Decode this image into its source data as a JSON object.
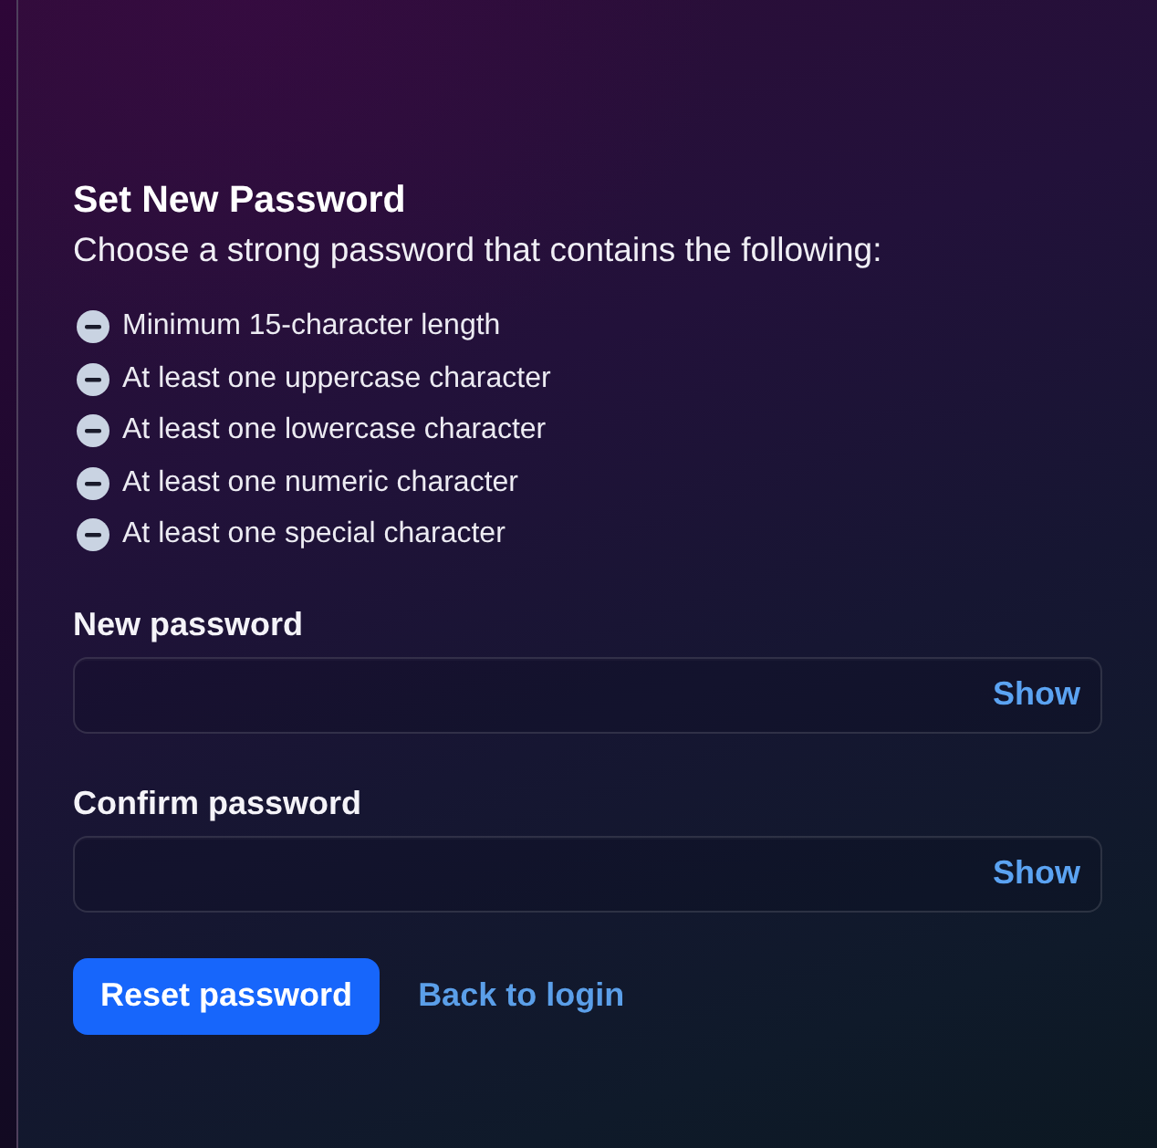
{
  "heading": {
    "title": "Set New Password",
    "subtitle": "Choose a strong password that contains the following:"
  },
  "requirements": [
    {
      "label": "Minimum 15-character length",
      "met": false
    },
    {
      "label": "At least one uppercase character",
      "met": false
    },
    {
      "label": "At least one lowercase character",
      "met": false
    },
    {
      "label": "At least one numeric character",
      "met": false
    },
    {
      "label": "At least one special character",
      "met": false
    }
  ],
  "fields": [
    {
      "label": "New password",
      "toggle": "Show"
    },
    {
      "label": "Confirm password",
      "toggle": "Show"
    }
  ],
  "actions": {
    "primary": "Reset password",
    "link": "Back to login"
  }
}
